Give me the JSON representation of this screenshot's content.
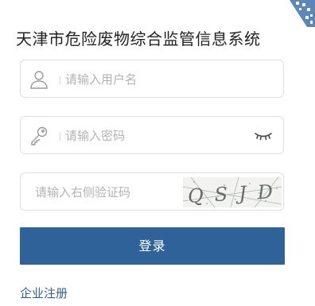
{
  "header": {
    "title": "天津市危险废物综合监管信息系统"
  },
  "form": {
    "username": {
      "value": "",
      "placeholder": "请输入用户名",
      "icon": "user-icon"
    },
    "password": {
      "value": "",
      "placeholder": "请输入密码",
      "icon": "key-icon",
      "toggle_icon": "eye-closed-icon"
    },
    "captcha": {
      "value": "",
      "placeholder": "请输入右侧验证码",
      "image_text": "QSJD"
    }
  },
  "actions": {
    "login_label": "登录",
    "register_link": "企业注册"
  },
  "colors": {
    "primary": "#2f6299",
    "border": "#dcdfe6",
    "placeholder": "#b3b3b3"
  }
}
